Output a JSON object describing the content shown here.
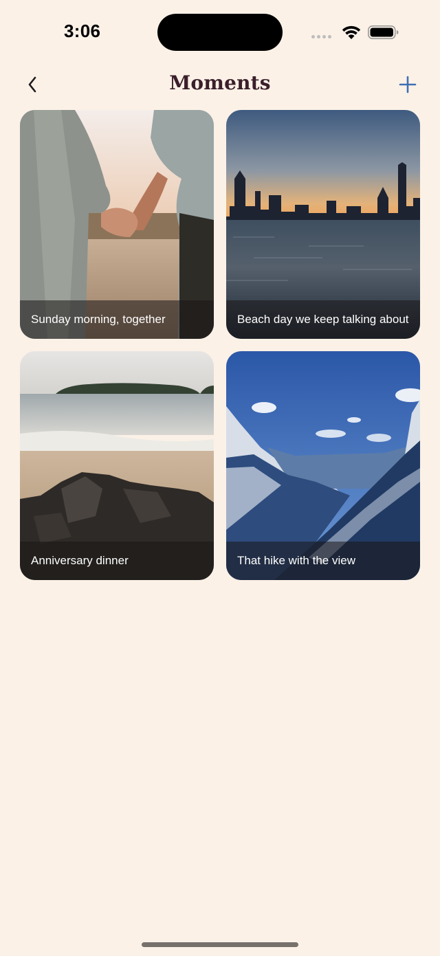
{
  "status": {
    "time": "3:06"
  },
  "nav": {
    "title": "Moments"
  },
  "colors": {
    "background": "#FBF1E7",
    "title": "#3A1F2B",
    "accent": "#3F6FB5"
  },
  "icons": {
    "back": "chevron-left-icon",
    "add": "plus-icon"
  },
  "moments": [
    {
      "caption": "Sunday morning, together",
      "image": "couple-holding-hands-beach-photo"
    },
    {
      "caption": "Beach day we keep talking about",
      "image": "city-skyline-lake-photo"
    },
    {
      "caption": "Anniversary dinner",
      "image": "rocky-beach-island-photo"
    },
    {
      "caption": "That hike with the view",
      "image": "snowy-mountain-valley-photo"
    }
  ]
}
